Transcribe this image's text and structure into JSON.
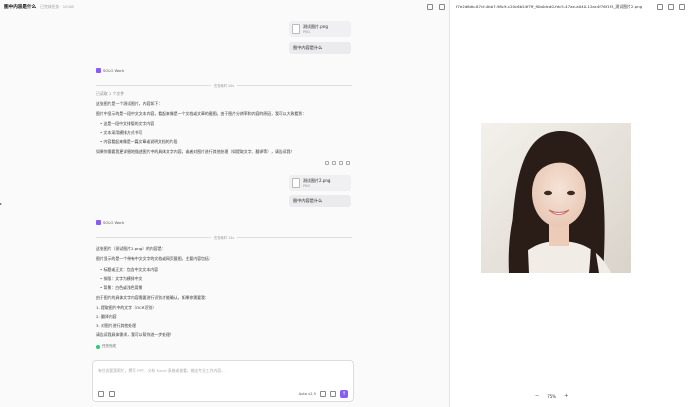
{
  "header": {
    "title": "图中内容是什么",
    "subtitle": "已完成任务 · 10:28"
  },
  "messages": [
    {
      "file_name": "测试图片.png",
      "file_type": "PNG",
      "question": "图中内容是什么"
    },
    {
      "file_name": "测试图片2.png",
      "file_type": "PNG",
      "question": "图中内容是什么"
    }
  ],
  "agent_name": "SOLO Work",
  "reply1": {
    "divider": "任务耗时 20s",
    "read_files": "已读取 1 个文件",
    "lines": [
      "这张图片是一个测试图片，内容如下：",
      "图片中显示的是一段中文文本内容，看起来像是一个文档或文章的截图。由于图片分辨率和内容的原因，我可以大致看到：",
      "• 这是一段中文排版的文字内容",
      "• 文本采用横排方式书写",
      "• 内容看起来像是一篇文章或说明文档的片段",
      "如果你需要我更详细地描述图片中的具体文字内容，或者对图片进行其他处理（如提取文字、翻译等），请告诉我！"
    ]
  },
  "reply2": {
    "divider": "任务耗时 14s",
    "lines": [
      "这张图片（测试图片2.png）的内容是：",
      "图片显示的是一个带有中文文字的文档或网页截图，主要内容包括：",
      "• 标题或正文：包含中文文本内容",
      "• 排版：文字为横排中文",
      "• 背景：白色或浅色背景",
      "由于图片的具体文字内容需要进行识别才能确认，如果你需要我：",
      "1. 提取图片中的文字（OCR识别）",
      "2. 翻译内容",
      "3. 对图片进行其他处理",
      "请告诉我具体需求，我可以帮你进一步处理！"
    ],
    "done": "任务完成"
  },
  "composer": {
    "placeholder": "有任务要我帮忙，撰写 PPT、分析 Excel 表格或查看，输出专业工作内容...",
    "model": "Auto v2.5",
    "send": "↑"
  },
  "right": {
    "file_name": "f7e2d8db-87cf-4bb7-98c9-c20c6b54f7ff_f0b0dcd0-fdc5-47ae-a040-12ac4f76f1f3_测试图片2.png",
    "zoom": "75%",
    "minus": "−",
    "plus": "+"
  },
  "icons": [
    "panel-icon",
    "close-icon",
    "pin-icon",
    "expand-icon",
    "attach-icon",
    "mention-icon",
    "mic-icon",
    "settings-icon",
    "copy-icon",
    "thumb-up-icon",
    "thumb-down-icon",
    "refresh-icon"
  ]
}
